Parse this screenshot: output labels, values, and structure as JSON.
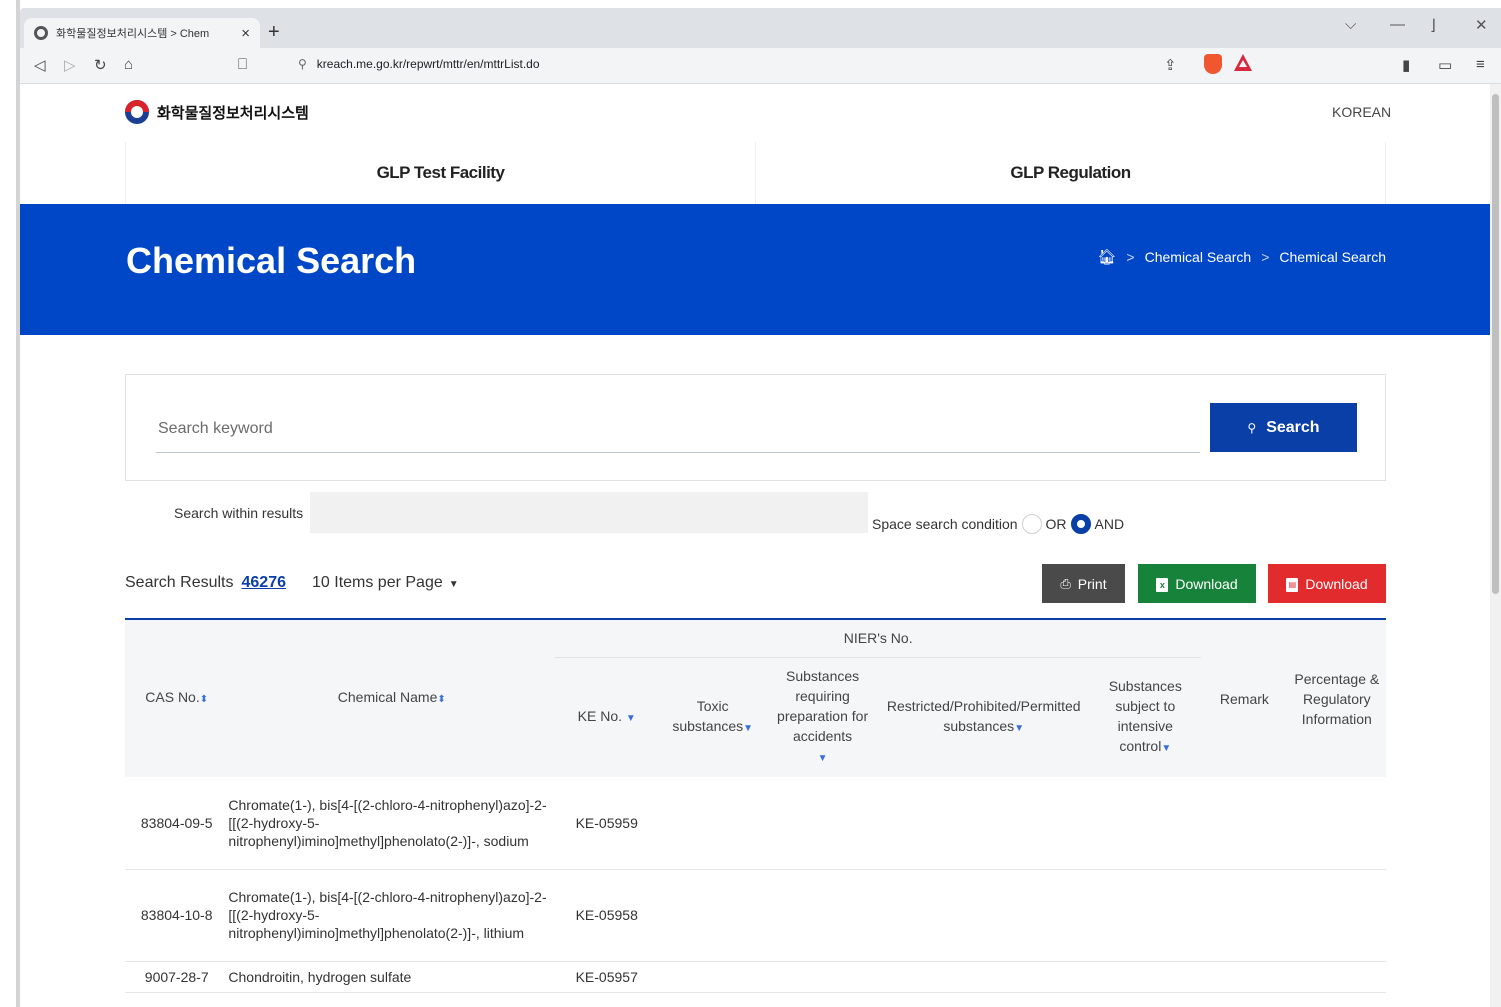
{
  "browser": {
    "tab_title": "화학물질정보처리시스템 > Chem",
    "url": "kreach.me.go.kr/repwrt/mttr/en/mttrList.do"
  },
  "header": {
    "logo_text": "화학물질정보처리시스템",
    "language": "KOREAN",
    "nav": [
      "GLP Test Facility",
      "GLP Regulation"
    ]
  },
  "hero": {
    "title": "Chemical Search",
    "breadcrumb": [
      "Chemical Search",
      "Chemical Search"
    ]
  },
  "search": {
    "placeholder": "Search keyword",
    "button": "Search",
    "within_label": "Search within results",
    "condition_label": "Space search condition",
    "options": [
      "OR",
      "AND"
    ],
    "selected": "AND"
  },
  "results": {
    "label": "Search Results",
    "count": "46276",
    "per_page": "10 Items per Page",
    "print": "Print",
    "download_excel": "Download",
    "download_pdf": "Download"
  },
  "table": {
    "group_header": "NIER's No.",
    "headers": {
      "cas": "CAS No.",
      "name": "Chemical Name",
      "ke": "KE No.",
      "toxic": "Toxic substances",
      "accident": "Substances requiring preparation for accidents",
      "restricted": "Restricted/Prohibited/Permitted substances",
      "intensive": "Substances subject to intensive control",
      "remark": "Remark",
      "percentage": "Percentage & Regulatory Information"
    },
    "rows": [
      {
        "cas": "83804-09-5",
        "name": "Chromate(1-), bis[4-[(2-chloro-4-nitrophenyl)azo]-2-[[(2-hydroxy-5-nitrophenyl)imino]methyl]phenolato(2-)]-, sodium",
        "ke": "KE-05959"
      },
      {
        "cas": "83804-10-8",
        "name": "Chromate(1-), bis[4-[(2-chloro-4-nitrophenyl)azo]-2-[[(2-hydroxy-5-nitrophenyl)imino]methyl]phenolato(2-)]-, lithium",
        "ke": "KE-05958"
      },
      {
        "cas": "9007-28-7",
        "name": "Chondroitin, hydrogen sulfate",
        "ke": "KE-05957"
      }
    ]
  }
}
